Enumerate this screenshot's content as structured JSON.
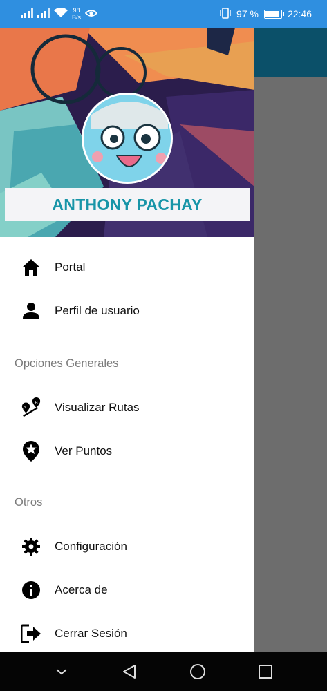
{
  "status_bar": {
    "net_speed_value": "98",
    "net_speed_unit": "B/s",
    "battery_percent": "97 %",
    "battery_level": 0.97,
    "time": "22:46"
  },
  "drawer": {
    "user_name": "ANTHONY PACHAY",
    "primary_items": [
      {
        "label": "Portal",
        "icon": "home-icon"
      },
      {
        "label": "Perfil de usuario",
        "icon": "person-icon"
      }
    ],
    "general_section": {
      "title": "Opciones Generales",
      "items": [
        {
          "label": "Visualizar Rutas",
          "icon": "route-icon"
        },
        {
          "label": "Ver Puntos",
          "icon": "star-pin-icon"
        }
      ]
    },
    "other_section": {
      "title": "Otros",
      "items": [
        {
          "label": "Configuración",
          "icon": "gear-icon"
        },
        {
          "label": "Acerca de",
          "icon": "info-icon"
        },
        {
          "label": "Cerrar Sesión",
          "icon": "logout-icon"
        }
      ]
    }
  },
  "colors": {
    "status_bar": "#2f8fe0",
    "app_bar": "#0b5069",
    "scrim": "#6d6d6d",
    "user_name": "#1895a8"
  },
  "nav_bar": {
    "icons": [
      "chevron-down-icon",
      "back-icon",
      "home-circle-icon",
      "recents-icon"
    ]
  }
}
